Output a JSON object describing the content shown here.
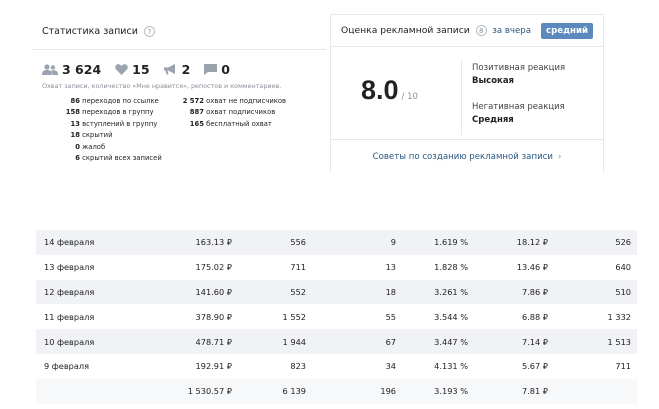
{
  "stats": {
    "title": "Статистика записи",
    "help": "?",
    "subscribers": "3 624",
    "likes": "15",
    "reposts": "2",
    "comments": "0",
    "description": "Охват записи, количество «Мне нравится», репостов и комментариев.",
    "left_items": [
      {
        "num": "86",
        "label": "переходов по ссылке"
      },
      {
        "num": "158",
        "label": "переходов в группу"
      },
      {
        "num": "13",
        "label": "вступлений в группу"
      },
      {
        "num": "18",
        "label": "скрытий"
      },
      {
        "num": "0",
        "label": "жалоб"
      },
      {
        "num": "6",
        "label": "скрытий всех записей"
      }
    ],
    "right_items": [
      {
        "num": "2 572",
        "label": "охват не подписчиков"
      },
      {
        "num": "887",
        "label": "охват подписчиков"
      },
      {
        "num": "165",
        "label": "бесплатный охват"
      }
    ]
  },
  "ad_rating": {
    "title": "Оценка рекламной записи",
    "badge": "8",
    "tab_yesterday": "за вчера",
    "tab_average": "средний",
    "score": "8.0",
    "score_max": "/ 10",
    "positive_label": "Позитивная реакция",
    "positive_value": "Высокая",
    "negative_label": "Негативная реакция",
    "negative_value": "Средняя",
    "footer_link": "Советы по созданию рекламной записи",
    "footer_arrow": "›"
  },
  "table": {
    "rows": [
      [
        "14 февраля",
        "163.13 ₽",
        "556",
        "9",
        "1.619 %",
        "18.12 ₽",
        "526"
      ],
      [
        "13 февраля",
        "175.02 ₽",
        "711",
        "13",
        "1.828 %",
        "13.46 ₽",
        "640"
      ],
      [
        "12 февраля",
        "141.60 ₽",
        "552",
        "18",
        "3.261 %",
        "7.86 ₽",
        "510"
      ],
      [
        "11 февраля",
        "378.90 ₽",
        "1 552",
        "55",
        "3.544 %",
        "6.88 ₽",
        "1 332"
      ],
      [
        "10 февраля",
        "478.71 ₽",
        "1 944",
        "67",
        "3.447 %",
        "7.14 ₽",
        "1 513"
      ],
      [
        "9 февраля",
        "192.91 ₽",
        "823",
        "34",
        "4.131 %",
        "5.67 ₽",
        "711"
      ]
    ],
    "total": [
      "",
      "1 530.57 ₽",
      "6 139",
      "196",
      "3.193 %",
      "7.81 ₽",
      ""
    ]
  }
}
